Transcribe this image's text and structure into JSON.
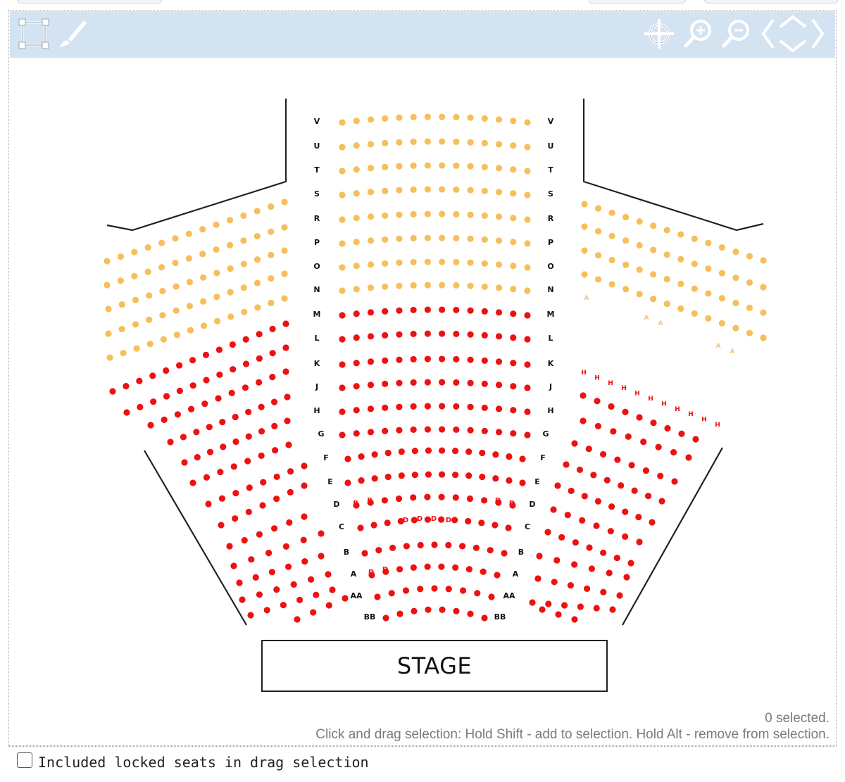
{
  "toolbar": {
    "left_tools": [
      {
        "name": "select-frame-icon"
      },
      {
        "name": "brush-icon"
      }
    ],
    "right_tools": [
      {
        "name": "crosshair-icon"
      },
      {
        "name": "zoom-in-icon"
      },
      {
        "name": "zoom-out-icon"
      },
      {
        "name": "pan-arrows-icon"
      }
    ],
    "icon_color": "#ffffff"
  },
  "colors": {
    "available": "#f7be5c",
    "booked": "#ee1111",
    "row_label": "#111111",
    "dim_label": "#f4c28a"
  },
  "row_labels": {
    "center": [
      "V",
      "U",
      "T",
      "S",
      "R",
      "P",
      "O",
      "N",
      "M",
      "L",
      "K",
      "J",
      "H",
      "G",
      "F",
      "E",
      "D",
      "C",
      "B",
      "A",
      "AA",
      "BB"
    ]
  },
  "special_seat_labels": {
    "h": "H",
    "d": "D",
    "b": "B",
    "triangle": "A"
  },
  "stage": {
    "label": "STAGE"
  },
  "status": {
    "selected": "0 selected.",
    "help": "Click and drag selection: Hold Shift - add to selection. Hold Alt - remove from selection."
  },
  "footer": {
    "checkbox_label": "Included locked seats in drag selection",
    "checked": false
  }
}
